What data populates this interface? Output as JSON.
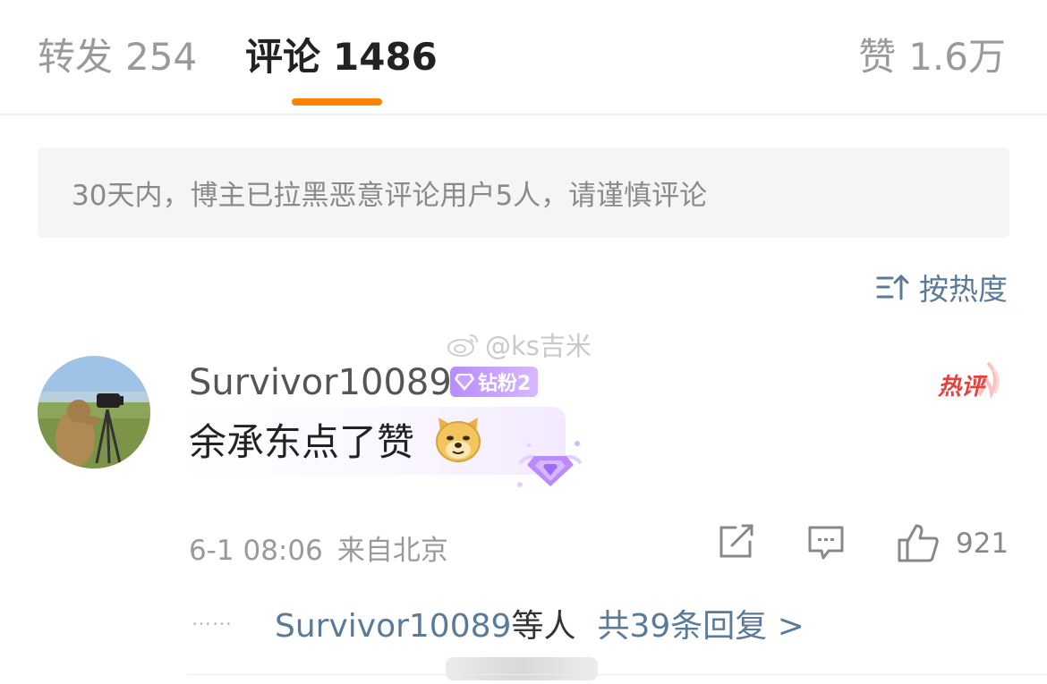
{
  "tabs": {
    "repost": {
      "label": "转发",
      "count": "254"
    },
    "comment": {
      "label": "评论",
      "count": "1486"
    },
    "like": {
      "label": "赞",
      "count": "1.6万"
    }
  },
  "notice": "30天内，博主已拉黑恶意评论用户5人，请谨慎评论",
  "sort": {
    "label": "按热度",
    "icon": "sort-icon"
  },
  "watermark": "@ks吉米",
  "comment": {
    "username": "Survivor10089",
    "badge": "钻粉2",
    "hot_label": "热评",
    "text": "余承东点了赞",
    "emoji": "doge-emoji",
    "time": "6-1 08:06",
    "location": "来自北京",
    "like_count": "921"
  },
  "replies": {
    "dots": "……",
    "user": "Survivor10089",
    "suffix": "等人",
    "total": "共39条回复 >"
  },
  "colors": {
    "accent": "#ff8200",
    "link": "#5a7a99",
    "badge": "#b98bff",
    "hot": "#e8413d"
  }
}
